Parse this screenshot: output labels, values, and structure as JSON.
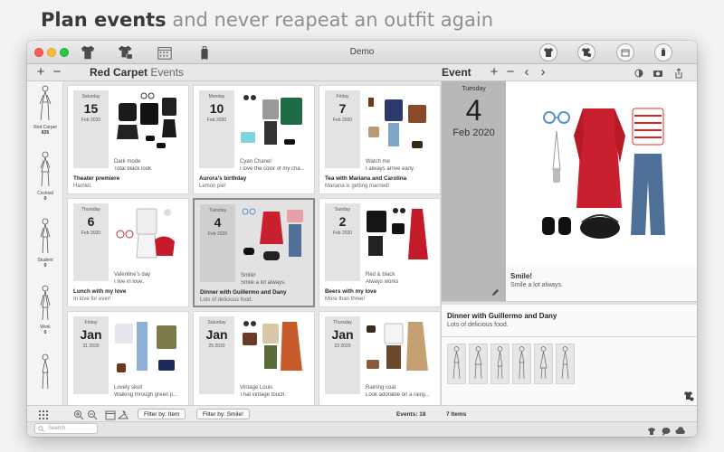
{
  "headline": {
    "bold": "Plan events",
    "rest": " and never reapeat an outfit again"
  },
  "window": {
    "title": "Demo"
  },
  "toolbar": {
    "add": "+",
    "remove": "−",
    "section_bold": "Red Carpet",
    "section_light": "Events",
    "event_title": "Event",
    "prev": "‹",
    "next": "›"
  },
  "sidebar": {
    "categories": [
      {
        "label": "Red Carpet",
        "count": "835"
      },
      {
        "label": "Cocktail",
        "count": "0"
      },
      {
        "label": "Student",
        "count": "0"
      },
      {
        "label": "Work",
        "count": "0"
      },
      {
        "label": "",
        "count": ""
      }
    ]
  },
  "events": [
    {
      "weekday": "Saturday",
      "day": "15",
      "month": "Feb",
      "year": "2020",
      "note1": "Dark mode",
      "note2": "Total black look.",
      "title": "Theater premiere",
      "subtitle": "Hamlet."
    },
    {
      "weekday": "Monday",
      "day": "10",
      "month": "Feb",
      "year": "2020",
      "note1": "Cyan Chanel",
      "note2": "I love the color of my cha...",
      "title": "Aurora's birthday",
      "subtitle": "Lemon pie!"
    },
    {
      "weekday": "Friday",
      "day": "7",
      "month": "Feb",
      "year": "2020",
      "note1": "Watch me",
      "note2": "I always arrive early.",
      "title": "Tea with Mariana and Carolina",
      "subtitle": "Mariana is getting married!"
    },
    {
      "weekday": "Thursday",
      "day": "6",
      "month": "Feb",
      "year": "2020",
      "note1": "Valentine's day",
      "note2": "I live in love.",
      "title": "Lunch with my love",
      "subtitle": "In love for ever!"
    },
    {
      "weekday": "Tuesday",
      "day": "4",
      "month": "Feb",
      "year": "2020",
      "note1": "Smile!",
      "note2": "Smile a lot always.",
      "title": "Dinner with Guillermo and Dany",
      "subtitle": "Lots of delicious food."
    },
    {
      "weekday": "Sunday",
      "day": "2",
      "month": "Feb",
      "year": "2020",
      "note1": "Red & black",
      "note2": "Always works",
      "title": "Beers with my love",
      "subtitle": "More than three!"
    },
    {
      "weekday": "Friday",
      "day": "Jan",
      "month": "31",
      "year": "2020",
      "note1": "Lovely skull",
      "note2": "Walking through green p...",
      "title": "",
      "subtitle": ""
    },
    {
      "weekday": "Saturday",
      "day": "Jan",
      "month": "25",
      "year": "2020",
      "note1": "Vintage Louis",
      "note2": "That vintage touch.",
      "title": "",
      "subtitle": ""
    },
    {
      "weekday": "Thursday",
      "day": "Jan",
      "month": "23",
      "year": "2020",
      "note1": "Raining coat",
      "note2": "Look adorable on a rainy...",
      "title": "",
      "subtitle": ""
    }
  ],
  "detail": {
    "weekday": "Tuesday",
    "day": "4",
    "month": "Feb",
    "year": "2020",
    "note1": "Smile!",
    "note2": "Smile a lot always.",
    "title": "Dinner with Guillermo and Dany",
    "subtitle": "Lots of delicious food."
  },
  "bottom": {
    "filter_item": "Filter by: Item",
    "filter_smile": "Filter by: Smile!",
    "events_count": "Events: 18",
    "items_count": "7 Items",
    "search_placeholder": "Search"
  },
  "colors": {
    "accent_red": "#c8202e",
    "selected_border": "#8a8a8a",
    "date_box": "#e3e3e3",
    "detail_date": "#b8b8b8"
  }
}
